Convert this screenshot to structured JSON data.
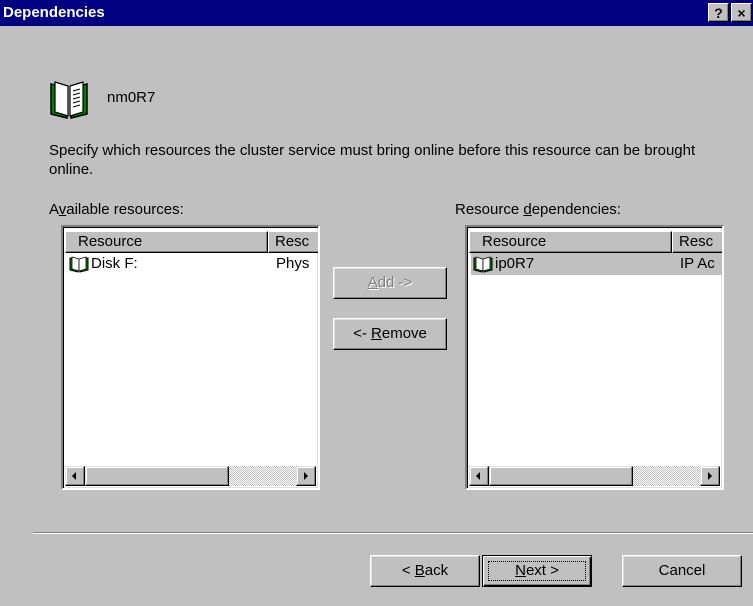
{
  "window": {
    "title": "Dependencies",
    "help_label": "?",
    "close_label": "×"
  },
  "resource": {
    "name": "nm0R7",
    "icon": "cluster-resource-book-icon"
  },
  "description": "Specify which resources the cluster service must bring online before this resource can be brought online.",
  "available": {
    "label_pre": "A",
    "label_key": "v",
    "label_post": "ailable resources:",
    "columns": [
      "Resource",
      "Resc"
    ],
    "rows": [
      {
        "resource": "Disk F:",
        "type": "Phys"
      }
    ]
  },
  "dependencies": {
    "label_pre": "Resource ",
    "label_key": "d",
    "label_post": "ependencies:",
    "columns": [
      "Resource",
      "Resc"
    ],
    "rows": [
      {
        "resource": "ip0R7",
        "type": "IP Ac"
      }
    ]
  },
  "buttons": {
    "add": {
      "pre": "",
      "key": "A",
      "post": "dd ->",
      "enabled": false
    },
    "remove": {
      "pre": "<- ",
      "key": "R",
      "post": "emove",
      "enabled": true
    },
    "back": {
      "pre": "< ",
      "key": "B",
      "post": "ack"
    },
    "next": {
      "pre": "",
      "key": "N",
      "post": "ext >"
    },
    "cancel": {
      "label": "Cancel"
    }
  },
  "colors": {
    "titlebar": "#000080",
    "face": "#c0c0c0",
    "icon_green": "#008000"
  }
}
